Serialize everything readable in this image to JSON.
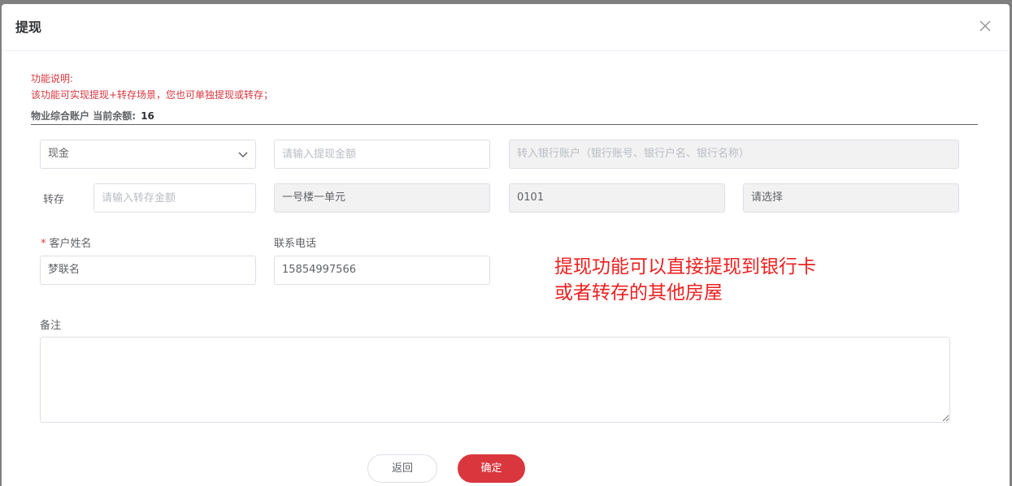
{
  "dialog": {
    "title": "提现",
    "close_icon": "close-icon"
  },
  "description": {
    "heading": "功能说明:",
    "text": "该功能可实现提现+转存场景，您也可单独提现或转存；"
  },
  "account": {
    "label": "物业综合账户",
    "balance_label": "当前余额:",
    "balance_value": "16"
  },
  "withdraw_row": {
    "method_value": "现金",
    "amount_placeholder": "请输入提现金额",
    "bank_placeholder": "转入银行账户（银行账号、银行户名、银行名称）"
  },
  "transfer_row": {
    "label": "转存",
    "amount_placeholder": "请输入转存金额",
    "building_value": "一号楼一单元",
    "room_value": "0101",
    "select_placeholder": "请选择"
  },
  "customer": {
    "name_label": "客户姓名",
    "name_value": "梦联名",
    "phone_label": "联系电话",
    "phone_value": "15854997566"
  },
  "annotation": {
    "line1": "提现功能可以直接提现到银行卡",
    "line2": "或者转存的其他房屋"
  },
  "remark": {
    "label": "备注",
    "value": ""
  },
  "buttons": {
    "back": "返回",
    "confirm": "确定"
  },
  "colors": {
    "accent": "#d9363e",
    "annotation": "#ee1f1f",
    "overlay": "#7f7f7f"
  }
}
